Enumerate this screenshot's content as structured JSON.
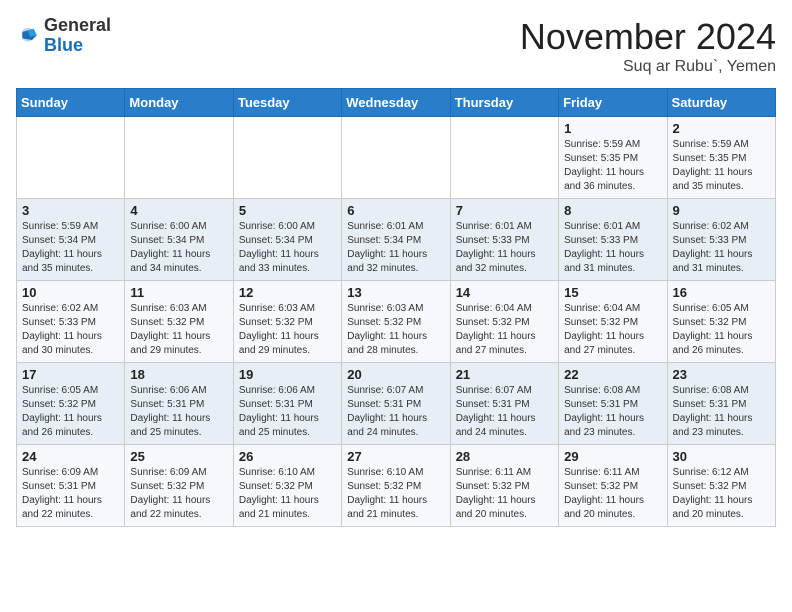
{
  "header": {
    "logo_line1": "General",
    "logo_line2": "Blue",
    "month_title": "November 2024",
    "location": "Suq ar Rubu`, Yemen"
  },
  "weekdays": [
    "Sunday",
    "Monday",
    "Tuesday",
    "Wednesday",
    "Thursday",
    "Friday",
    "Saturday"
  ],
  "weeks": [
    [
      {
        "day": "",
        "info": ""
      },
      {
        "day": "",
        "info": ""
      },
      {
        "day": "",
        "info": ""
      },
      {
        "day": "",
        "info": ""
      },
      {
        "day": "",
        "info": ""
      },
      {
        "day": "1",
        "info": "Sunrise: 5:59 AM\nSunset: 5:35 PM\nDaylight: 11 hours and 36 minutes."
      },
      {
        "day": "2",
        "info": "Sunrise: 5:59 AM\nSunset: 5:35 PM\nDaylight: 11 hours and 35 minutes."
      }
    ],
    [
      {
        "day": "3",
        "info": "Sunrise: 5:59 AM\nSunset: 5:34 PM\nDaylight: 11 hours and 35 minutes."
      },
      {
        "day": "4",
        "info": "Sunrise: 6:00 AM\nSunset: 5:34 PM\nDaylight: 11 hours and 34 minutes."
      },
      {
        "day": "5",
        "info": "Sunrise: 6:00 AM\nSunset: 5:34 PM\nDaylight: 11 hours and 33 minutes."
      },
      {
        "day": "6",
        "info": "Sunrise: 6:01 AM\nSunset: 5:34 PM\nDaylight: 11 hours and 32 minutes."
      },
      {
        "day": "7",
        "info": "Sunrise: 6:01 AM\nSunset: 5:33 PM\nDaylight: 11 hours and 32 minutes."
      },
      {
        "day": "8",
        "info": "Sunrise: 6:01 AM\nSunset: 5:33 PM\nDaylight: 11 hours and 31 minutes."
      },
      {
        "day": "9",
        "info": "Sunrise: 6:02 AM\nSunset: 5:33 PM\nDaylight: 11 hours and 31 minutes."
      }
    ],
    [
      {
        "day": "10",
        "info": "Sunrise: 6:02 AM\nSunset: 5:33 PM\nDaylight: 11 hours and 30 minutes."
      },
      {
        "day": "11",
        "info": "Sunrise: 6:03 AM\nSunset: 5:32 PM\nDaylight: 11 hours and 29 minutes."
      },
      {
        "day": "12",
        "info": "Sunrise: 6:03 AM\nSunset: 5:32 PM\nDaylight: 11 hours and 29 minutes."
      },
      {
        "day": "13",
        "info": "Sunrise: 6:03 AM\nSunset: 5:32 PM\nDaylight: 11 hours and 28 minutes."
      },
      {
        "day": "14",
        "info": "Sunrise: 6:04 AM\nSunset: 5:32 PM\nDaylight: 11 hours and 27 minutes."
      },
      {
        "day": "15",
        "info": "Sunrise: 6:04 AM\nSunset: 5:32 PM\nDaylight: 11 hours and 27 minutes."
      },
      {
        "day": "16",
        "info": "Sunrise: 6:05 AM\nSunset: 5:32 PM\nDaylight: 11 hours and 26 minutes."
      }
    ],
    [
      {
        "day": "17",
        "info": "Sunrise: 6:05 AM\nSunset: 5:32 PM\nDaylight: 11 hours and 26 minutes."
      },
      {
        "day": "18",
        "info": "Sunrise: 6:06 AM\nSunset: 5:31 PM\nDaylight: 11 hours and 25 minutes."
      },
      {
        "day": "19",
        "info": "Sunrise: 6:06 AM\nSunset: 5:31 PM\nDaylight: 11 hours and 25 minutes."
      },
      {
        "day": "20",
        "info": "Sunrise: 6:07 AM\nSunset: 5:31 PM\nDaylight: 11 hours and 24 minutes."
      },
      {
        "day": "21",
        "info": "Sunrise: 6:07 AM\nSunset: 5:31 PM\nDaylight: 11 hours and 24 minutes."
      },
      {
        "day": "22",
        "info": "Sunrise: 6:08 AM\nSunset: 5:31 PM\nDaylight: 11 hours and 23 minutes."
      },
      {
        "day": "23",
        "info": "Sunrise: 6:08 AM\nSunset: 5:31 PM\nDaylight: 11 hours and 23 minutes."
      }
    ],
    [
      {
        "day": "24",
        "info": "Sunrise: 6:09 AM\nSunset: 5:31 PM\nDaylight: 11 hours and 22 minutes."
      },
      {
        "day": "25",
        "info": "Sunrise: 6:09 AM\nSunset: 5:32 PM\nDaylight: 11 hours and 22 minutes."
      },
      {
        "day": "26",
        "info": "Sunrise: 6:10 AM\nSunset: 5:32 PM\nDaylight: 11 hours and 21 minutes."
      },
      {
        "day": "27",
        "info": "Sunrise: 6:10 AM\nSunset: 5:32 PM\nDaylight: 11 hours and 21 minutes."
      },
      {
        "day": "28",
        "info": "Sunrise: 6:11 AM\nSunset: 5:32 PM\nDaylight: 11 hours and 20 minutes."
      },
      {
        "day": "29",
        "info": "Sunrise: 6:11 AM\nSunset: 5:32 PM\nDaylight: 11 hours and 20 minutes."
      },
      {
        "day": "30",
        "info": "Sunrise: 6:12 AM\nSunset: 5:32 PM\nDaylight: 11 hours and 20 minutes."
      }
    ]
  ]
}
